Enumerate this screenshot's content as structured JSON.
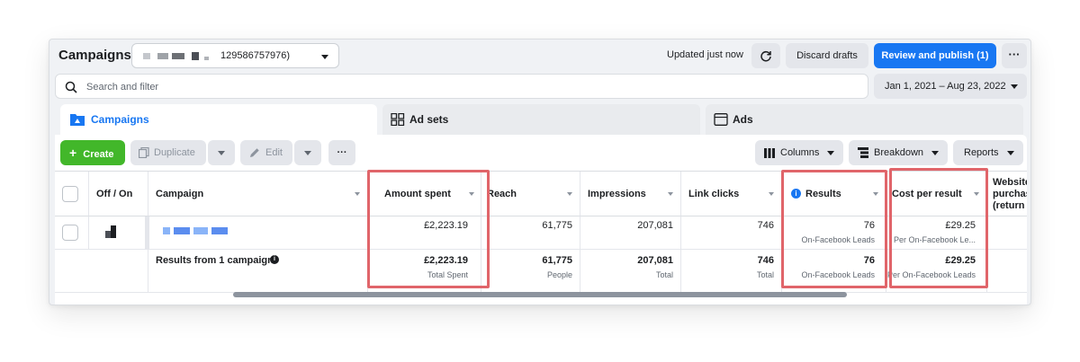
{
  "header": {
    "title": "Campaigns",
    "account_suffix": "129586757976)",
    "updated_text": "Updated just now",
    "discard_label": "Discard drafts",
    "publish_label": "Review and publish (1)",
    "more_label": "···"
  },
  "search": {
    "placeholder": "Search and filter",
    "date_range": "Jan 1, 2021 – Aug 23, 2022"
  },
  "tabs": [
    {
      "label": "Campaigns",
      "icon": "folder-icon",
      "active": true
    },
    {
      "label": "Ad sets",
      "icon": "grid-icon",
      "active": false
    },
    {
      "label": "Ads",
      "icon": "ad-card-icon",
      "active": false
    }
  ],
  "toolbar": {
    "create_label": "Create",
    "duplicate_label": "Duplicate",
    "edit_label": "Edit",
    "more_label": "···",
    "columns_label": "Columns",
    "breakdown_label": "Breakdown",
    "reports_label": "Reports"
  },
  "table": {
    "headers": {
      "off_on": "Off / On",
      "campaign": "Campaign",
      "amount_spent": "Amount spent",
      "reach": "Reach",
      "impressions": "Impressions",
      "link_clicks": "Link clicks",
      "results": "Results",
      "cost_per_result": "Cost per result",
      "website_1": "Website",
      "website_2": "purchase",
      "website_3": "(return o"
    },
    "row1": {
      "amount_spent": "£2,223.19",
      "reach": "61,775",
      "impressions": "207,081",
      "link_clicks": "746",
      "results": "76",
      "results_sub": "On-Facebook Leads",
      "cost_per_result": "£29.25",
      "cost_per_result_sub": "Per On-Facebook Le..."
    },
    "summary": {
      "label": "Results from 1 campaign",
      "amount_spent": "£2,223.19",
      "amount_spent_sub": "Total Spent",
      "reach": "61,775",
      "reach_sub": "People",
      "impressions": "207,081",
      "impressions_sub": "Total",
      "link_clicks": "746",
      "link_clicks_sub": "Total",
      "results": "76",
      "results_sub": "On-Facebook Leads",
      "cost_per_result": "£29.25",
      "cost_per_result_sub": "Per On-Facebook Leads"
    }
  },
  "colors": {
    "primary": "#1877f2",
    "create": "#42b72a",
    "highlight": "#e0656a"
  }
}
